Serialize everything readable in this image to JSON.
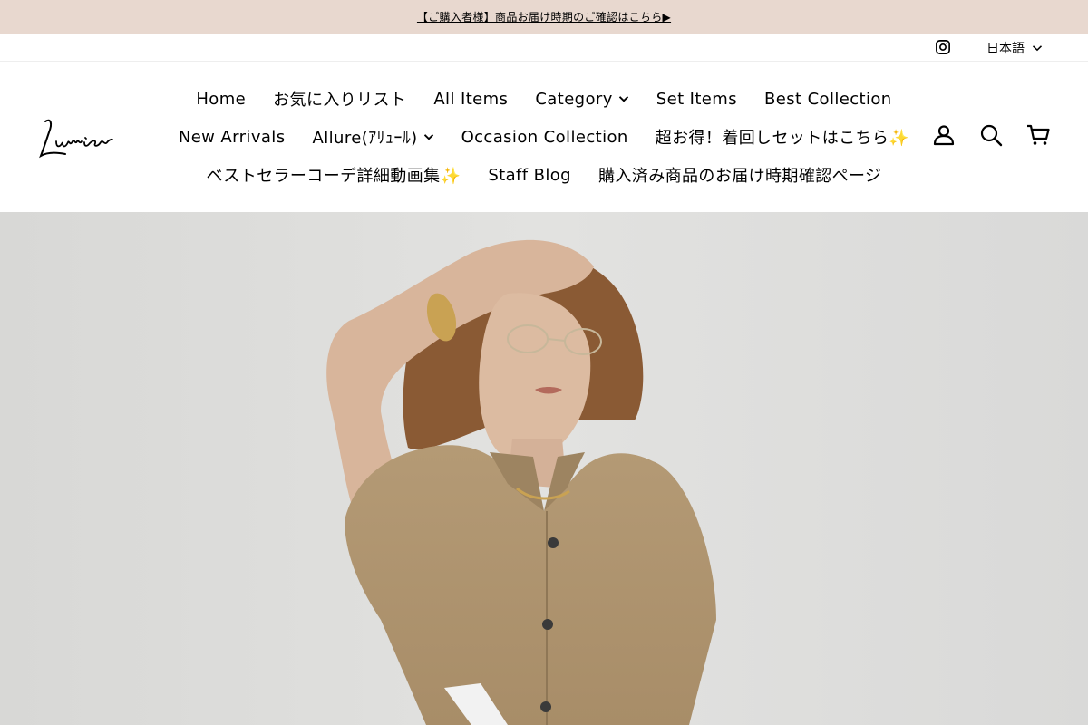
{
  "announcement": {
    "text": "【ご購入者様】商品お届け時期のご確認はこちら▶"
  },
  "topbar": {
    "instagram_icon": "instagram-icon",
    "language": "日本語"
  },
  "logo": {
    "text": "Lumier"
  },
  "nav": {
    "row1": [
      {
        "label": "Home",
        "dropdown": false
      },
      {
        "label": "お気に入りリスト",
        "dropdown": false
      },
      {
        "label": "All Items",
        "dropdown": false
      },
      {
        "label": "Category",
        "dropdown": true
      },
      {
        "label": "Set Items",
        "dropdown": false
      },
      {
        "label": "Best Collection",
        "dropdown": false
      }
    ],
    "row2": [
      {
        "label": "New Arrivals",
        "dropdown": false
      },
      {
        "label": "Allure(ｱﾘｭｰﾙ)",
        "dropdown": true
      },
      {
        "label": "Occasion Collection",
        "dropdown": false
      },
      {
        "label": "超お得！着回しセットはこちら✨",
        "dropdown": false
      }
    ],
    "row3": [
      {
        "label": "ベストセラーコーデ詳細動画集✨",
        "dropdown": false
      },
      {
        "label": "Staff Blog",
        "dropdown": false
      },
      {
        "label": "購入済み商品のお届け時期確認ページ",
        "dropdown": false
      }
    ]
  },
  "header_icons": [
    "account-icon",
    "search-icon",
    "cart-icon"
  ],
  "colors": {
    "announcement_bg": "#e8d8cf",
    "text": "#000000"
  }
}
